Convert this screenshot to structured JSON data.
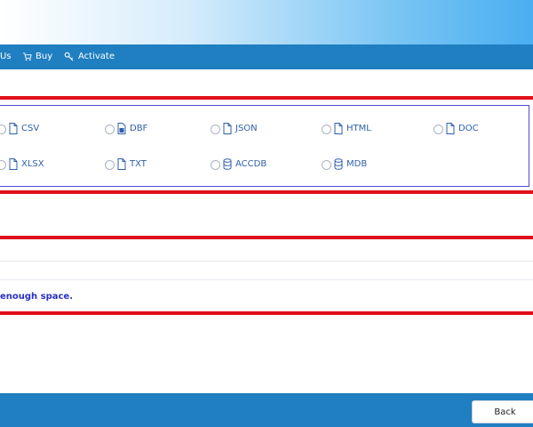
{
  "menubar": {
    "items": [
      {
        "label": "Us",
        "icon": "none"
      },
      {
        "label": "Buy",
        "icon": "cart-icon"
      },
      {
        "label": "Activate",
        "icon": "key-icon"
      }
    ]
  },
  "formats": {
    "row1": [
      {
        "label": "CSV",
        "icon": "file-icon"
      },
      {
        "label": "DBF",
        "icon": "database-file-icon"
      },
      {
        "label": "JSON",
        "icon": "file-icon"
      },
      {
        "label": "HTML",
        "icon": "file-icon"
      },
      {
        "label": "DOC",
        "icon": "file-icon"
      }
    ],
    "row2": [
      {
        "label": "XLSX",
        "icon": "file-icon"
      },
      {
        "label": "TXT",
        "icon": "file-icon"
      },
      {
        "label": "ACCDB",
        "icon": "database-icon"
      },
      {
        "label": "MDB",
        "icon": "database-icon"
      }
    ]
  },
  "status": {
    "message": "enough space."
  },
  "footer": {
    "back_label": "Back"
  },
  "colors": {
    "accent": "#1f7fc1",
    "highlight_red": "#e0101a",
    "message_blue": "#2a2fc4"
  }
}
